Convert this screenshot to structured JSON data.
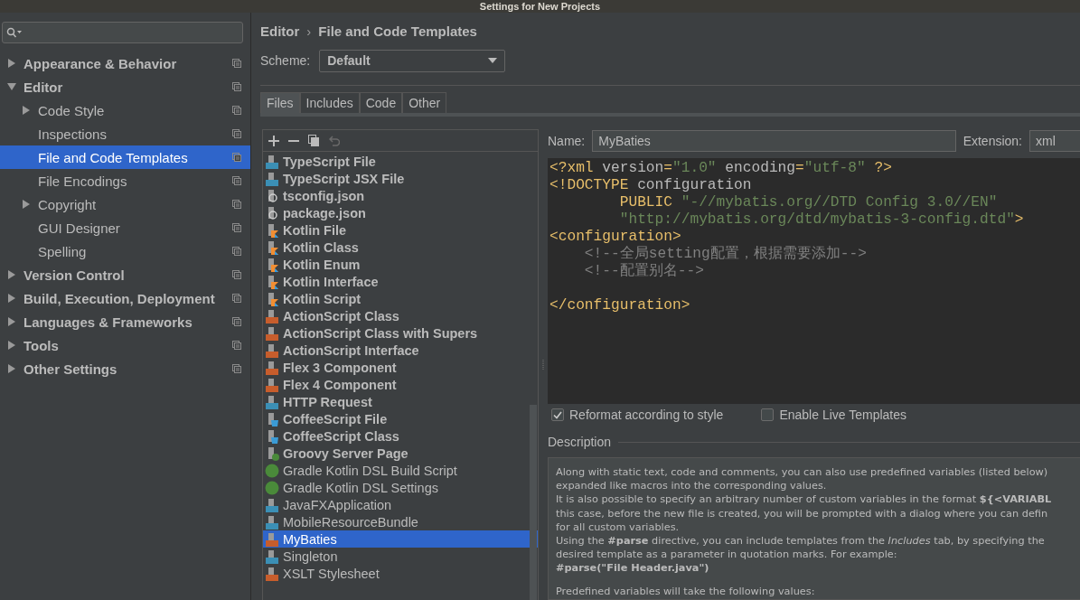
{
  "window": {
    "title": "Settings for New Projects"
  },
  "sidebar": {
    "items": [
      {
        "label": "Appearance & Behavior",
        "bold": true,
        "expanded": false,
        "selected": false
      },
      {
        "label": "Editor",
        "bold": true,
        "expanded": true,
        "selected": false,
        "children": [
          {
            "label": "Code Style",
            "bold": false,
            "expanded": false,
            "selected": false
          },
          {
            "label": "Inspections",
            "bold": false,
            "selected": false
          },
          {
            "label": "File and Code Templates",
            "bold": false,
            "selected": true
          },
          {
            "label": "File Encodings",
            "bold": false,
            "selected": false
          },
          {
            "label": "Copyright",
            "bold": false,
            "expanded": false,
            "selected": false
          },
          {
            "label": "GUI Designer",
            "bold": false,
            "selected": false
          },
          {
            "label": "Spelling",
            "bold": false,
            "selected": false
          }
        ]
      },
      {
        "label": "Version Control",
        "bold": true,
        "expanded": false,
        "selected": false
      },
      {
        "label": "Build, Execution, Deployment",
        "bold": true,
        "expanded": false,
        "selected": false
      },
      {
        "label": "Languages & Frameworks",
        "bold": true,
        "expanded": false,
        "selected": false
      },
      {
        "label": "Tools",
        "bold": true,
        "expanded": false,
        "selected": false
      },
      {
        "label": "Other Settings",
        "bold": true,
        "expanded": false,
        "selected": false
      }
    ]
  },
  "breadcrumb": {
    "parent": "Editor",
    "separator": "›",
    "current": "File and Code Templates"
  },
  "scheme": {
    "label": "Scheme:",
    "value": "Default"
  },
  "tabs": [
    {
      "label": "Files",
      "selected": true
    },
    {
      "label": "Includes",
      "selected": false
    },
    {
      "label": "Code",
      "selected": false
    },
    {
      "label": "Other",
      "selected": false
    }
  ],
  "templates": [
    {
      "label": "TypeScript File",
      "kind": "ts",
      "bold": true,
      "selected": false
    },
    {
      "label": "TypeScript JSX File",
      "kind": "ts",
      "bold": true,
      "selected": false
    },
    {
      "label": "tsconfig.json",
      "kind": "json",
      "bold": true,
      "selected": false
    },
    {
      "label": "package.json",
      "kind": "json",
      "bold": true,
      "selected": false
    },
    {
      "label": "Kotlin File",
      "kind": "kotlin",
      "bold": true,
      "selected": false
    },
    {
      "label": "Kotlin Class",
      "kind": "kotlin",
      "bold": true,
      "selected": false
    },
    {
      "label": "Kotlin Enum",
      "kind": "kotlin",
      "bold": true,
      "selected": false
    },
    {
      "label": "Kotlin Interface",
      "kind": "kotlin",
      "bold": true,
      "selected": false
    },
    {
      "label": "Kotlin Script",
      "kind": "kotlin",
      "bold": true,
      "selected": false
    },
    {
      "label": "ActionScript Class",
      "kind": "actionscript",
      "bold": true,
      "selected": false
    },
    {
      "label": "ActionScript Class with Supers",
      "kind": "actionscript",
      "bold": true,
      "selected": false
    },
    {
      "label": "ActionScript Interface",
      "kind": "actionscript",
      "bold": true,
      "selected": false
    },
    {
      "label": "Flex 3 Component",
      "kind": "markup",
      "bold": true,
      "selected": false
    },
    {
      "label": "Flex 4 Component",
      "kind": "markup",
      "bold": true,
      "selected": false
    },
    {
      "label": "HTTP Request",
      "kind": "api",
      "bold": true,
      "selected": false
    },
    {
      "label": "CoffeeScript File",
      "kind": "coffee",
      "bold": true,
      "selected": false
    },
    {
      "label": "CoffeeScript Class",
      "kind": "coffee",
      "bold": true,
      "selected": false
    },
    {
      "label": "Groovy Server Page",
      "kind": "groovy",
      "bold": true,
      "selected": false
    },
    {
      "label": "Gradle Kotlin DSL Build Script",
      "kind": "gradle",
      "bold": false,
      "selected": false
    },
    {
      "label": "Gradle Kotlin DSL Settings",
      "kind": "gradle",
      "bold": false,
      "selected": false
    },
    {
      "label": "JavaFXApplication",
      "kind": "java",
      "bold": false,
      "selected": false
    },
    {
      "label": "MobileResourceBundle",
      "kind": "java",
      "bold": false,
      "selected": false
    },
    {
      "label": "MyBaties",
      "kind": "markup",
      "bold": false,
      "selected": true
    },
    {
      "label": "Singleton",
      "kind": "java",
      "bold": false,
      "selected": false
    },
    {
      "label": "XSLT Stylesheet",
      "kind": "markup",
      "bold": false,
      "selected": false
    }
  ],
  "name_field": {
    "label": "Name:",
    "value": "MyBaties"
  },
  "extension_field": {
    "label": "Extension:",
    "value": "xml"
  },
  "code_lines": [
    {
      "kind": "code",
      "tokens": [
        {
          "text": "<?xml ",
          "kind": "tag"
        },
        {
          "text": "version",
          "kind": "attr"
        },
        {
          "text": "=",
          "kind": "tag"
        },
        {
          "text": "\"1.0\"",
          "kind": "string"
        },
        {
          "text": " encoding",
          "kind": "attr"
        },
        {
          "text": "=",
          "kind": "tag"
        },
        {
          "text": "\"utf-8\"",
          "kind": "string"
        },
        {
          "text": " ?>",
          "kind": "tag"
        }
      ]
    },
    {
      "kind": "code",
      "tokens": [
        {
          "text": "<!DOCTYPE ",
          "kind": "tag"
        },
        {
          "text": "configuration",
          "kind": "attr"
        }
      ]
    },
    {
      "kind": "code",
      "tokens": [
        {
          "text": "        PUBLIC ",
          "kind": "tag"
        },
        {
          "text": "\"-//mybatis.org//DTD Config 3.0//EN\"",
          "kind": "string"
        }
      ]
    },
    {
      "kind": "code",
      "tokens": [
        {
          "text": "        \"http://mybatis.org/dtd/mybatis-3-config.dtd\"",
          "kind": "string"
        },
        {
          "text": ">",
          "kind": "tag"
        }
      ]
    },
    {
      "kind": "code",
      "tokens": [
        {
          "text": "<configuration>",
          "kind": "tag"
        }
      ]
    },
    {
      "kind": "code",
      "tokens": [
        {
          "text": "    <!--全局setting配置，根据需要添加-->",
          "kind": "comment"
        }
      ]
    },
    {
      "kind": "code",
      "tokens": [
        {
          "text": "    <!--配置别名-->",
          "kind": "comment"
        }
      ]
    },
    {
      "kind": "blank"
    },
    {
      "kind": "code",
      "tokens": [
        {
          "text": "</configuration>",
          "kind": "tag"
        }
      ]
    }
  ],
  "options": [
    {
      "label": "Reformat according to style",
      "checked": true
    },
    {
      "label": "Enable Live Templates",
      "checked": false
    }
  ],
  "description": {
    "title": "Description",
    "lines": [
      {
        "text": "Along with static text, code and comments, you can also use predefined variables (listed below)",
        "kind": "text"
      },
      {
        "text": "expanded like macros into the corresponding values.",
        "kind": "text"
      },
      {
        "text": "It is also possible to specify an arbitrary number of custom variables in the format **${<VARIABL**",
        "kind": "text"
      },
      {
        "text": "this case, before the new file is created, you will be prompted with a dialog where you can defin",
        "kind": "text"
      },
      {
        "text": "for all custom variables.",
        "kind": "text"
      },
      {
        "text": "Using the **#parse** directive, you can include templates from the *Includes* tab, by specifying the",
        "kind": "text"
      },
      {
        "text": "desired template as a parameter in quotation marks. For example:",
        "kind": "text"
      },
      {
        "text": "#parse(\"File Header.java\")",
        "kind": "code"
      },
      {
        "text": "Predefined variables will take the following values:",
        "kind": "gap"
      }
    ]
  }
}
